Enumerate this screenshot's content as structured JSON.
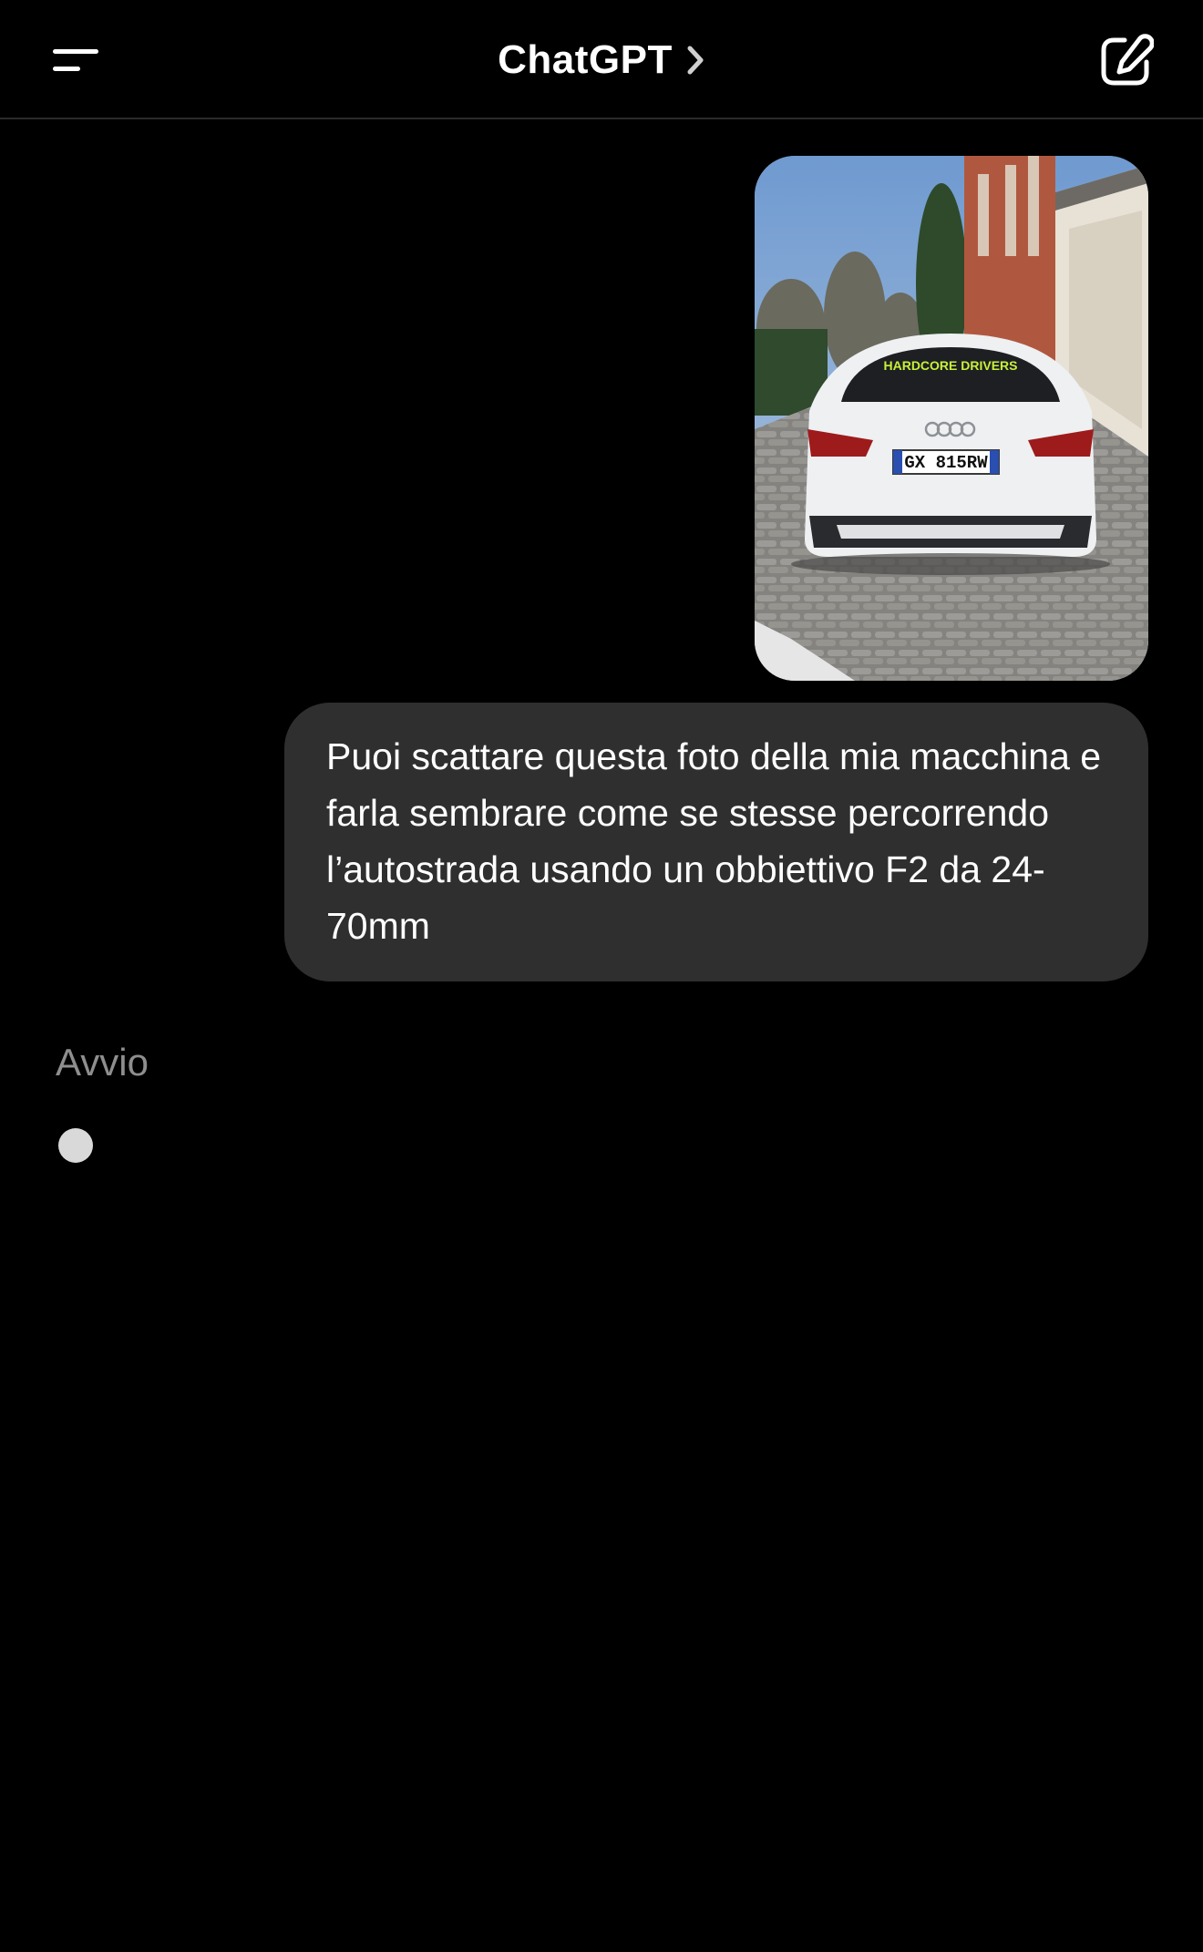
{
  "header": {
    "title": "ChatGPT",
    "menu_icon": "menu-icon",
    "chevron_icon": "chevron-right-icon",
    "new_chat_icon": "compose-icon"
  },
  "conversation": {
    "user_image": {
      "alt": "Foto di un'auto bianca parcheggiata",
      "plate": "GX 815RW",
      "windshield_banner": "HARDCORE DRIVERS"
    },
    "user_message": "Puoi scattare questa foto della mia macchina e farla sembrare come se stesse percorrendo l’autostrada usando un obbiettivo F2 da 24-70mm"
  },
  "status": {
    "label": "Avvio"
  },
  "colors": {
    "background": "#000000",
    "bubble": "#2f2f2f",
    "status_text": "#8e8e8e",
    "dot": "#d9d9d9"
  }
}
